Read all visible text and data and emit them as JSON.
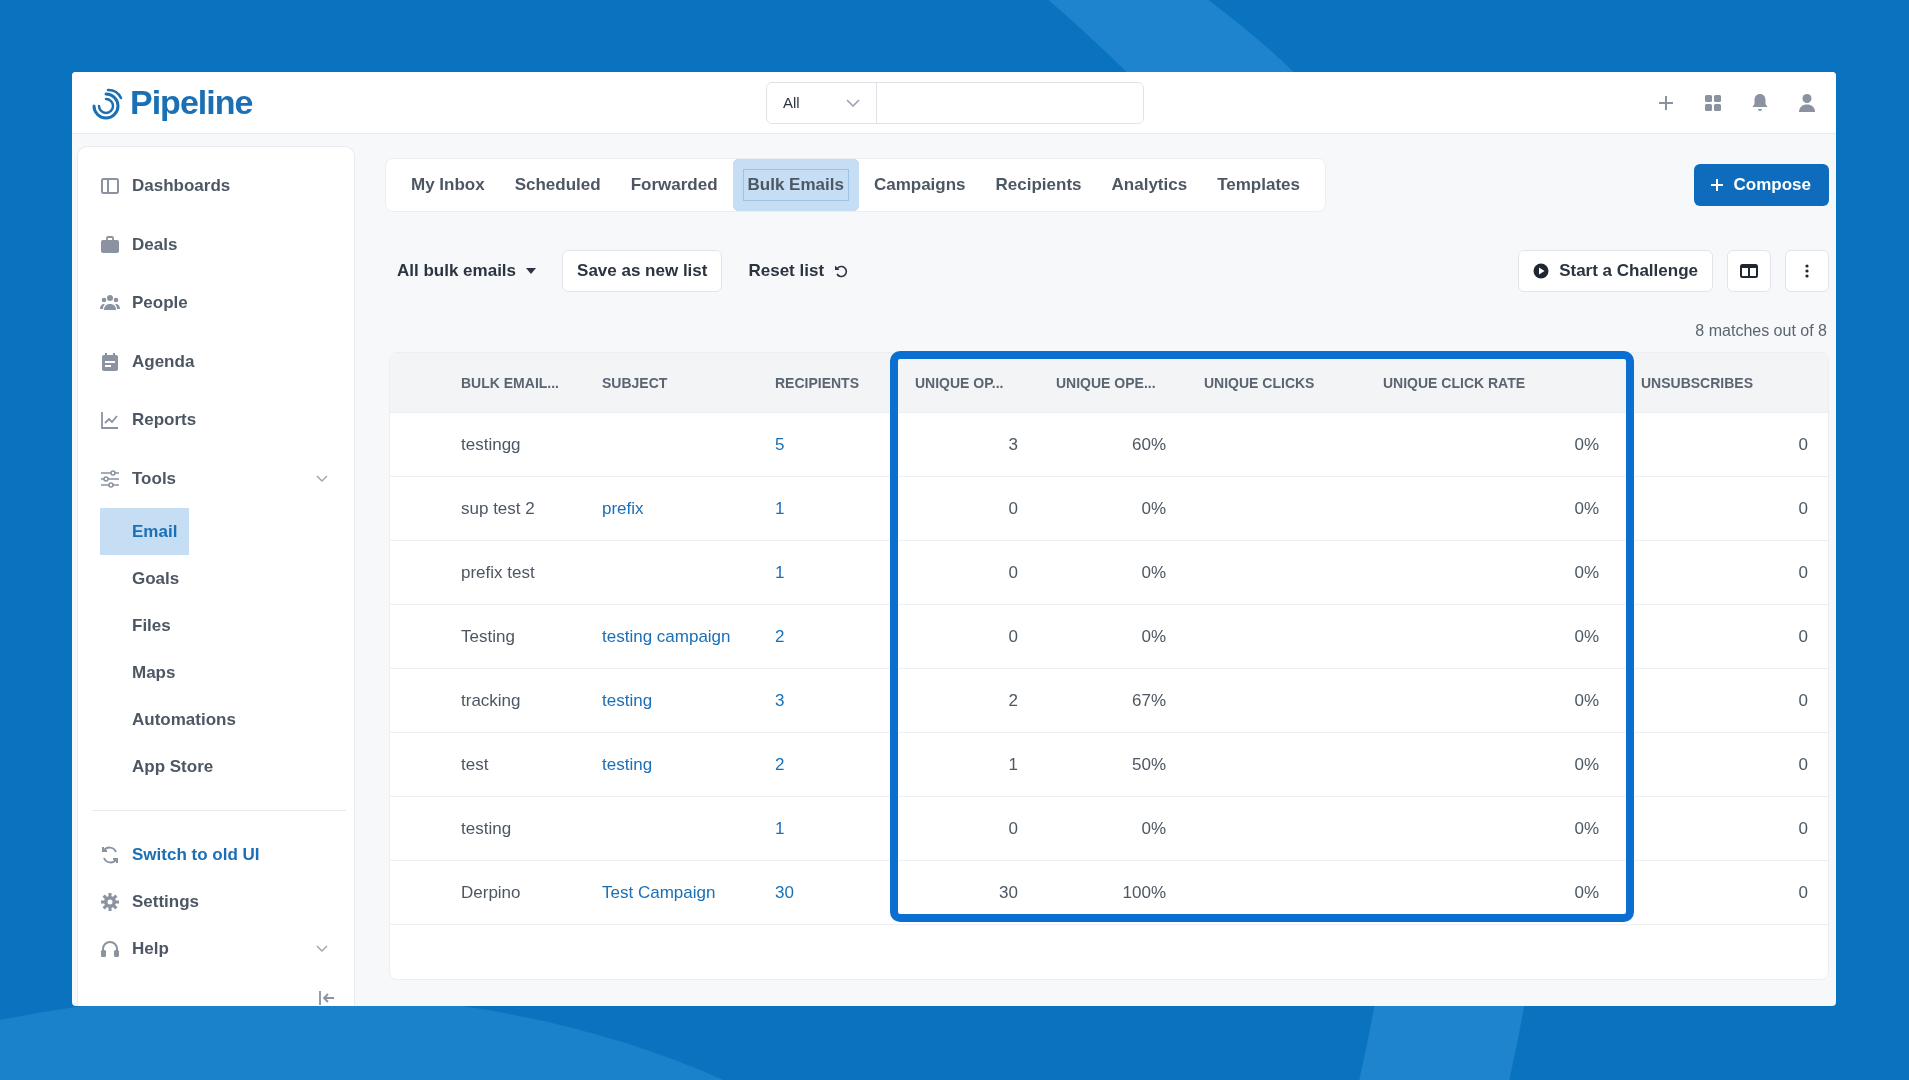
{
  "app": {
    "name": "Pipeline"
  },
  "search": {
    "scope": "All"
  },
  "sidebar": {
    "items": [
      {
        "label": "Dashboards",
        "selected": false
      },
      {
        "label": "Deals",
        "selected": false
      },
      {
        "label": "People",
        "selected": false
      },
      {
        "label": "Agenda",
        "selected": false
      },
      {
        "label": "Reports",
        "selected": false
      },
      {
        "label": "Tools",
        "selected": false,
        "expanded": true,
        "children": [
          {
            "label": "Email",
            "selected": true
          },
          {
            "label": "Goals",
            "selected": false
          },
          {
            "label": "Files",
            "selected": false
          },
          {
            "label": "Maps",
            "selected": false
          },
          {
            "label": "Automations",
            "selected": false
          },
          {
            "label": "App Store",
            "selected": false
          }
        ]
      }
    ],
    "footer": [
      {
        "label": "Switch to old UI",
        "kind": "link"
      },
      {
        "label": "Settings",
        "kind": "item"
      },
      {
        "label": "Help",
        "kind": "menu"
      }
    ]
  },
  "tabs": [
    {
      "label": "My Inbox",
      "selected": false
    },
    {
      "label": "Scheduled",
      "selected": false
    },
    {
      "label": "Forwarded",
      "selected": false
    },
    {
      "label": "Bulk Emails",
      "selected": true
    },
    {
      "label": "Campaigns",
      "selected": false
    },
    {
      "label": "Recipients",
      "selected": false
    },
    {
      "label": "Analytics",
      "selected": false
    },
    {
      "label": "Templates",
      "selected": false
    }
  ],
  "compose_button": "Compose",
  "toolbar": {
    "list_selector": "All bulk emails",
    "save_button": "Save as new list",
    "reset_button": "Reset list",
    "challenge_button": "Start a Challenge"
  },
  "match_count": "8 matches out of 8",
  "table": {
    "columns": [
      "BULK EMAIL...",
      "SUBJECT",
      "RECIPIENTS",
      "UNIQUE OP...",
      "UNIQUE OPE...",
      "UNIQUE CLICKS",
      "UNIQUE CLICK RATE",
      "UNSUBSCRIBES"
    ],
    "rows": [
      {
        "name": "testingg",
        "recipients": "5",
        "unique_opens": "3",
        "unique_open_rate": "60%",
        "unique_click_rate": "0%",
        "unsubscribes": "0"
      },
      {
        "name": "sup test 2",
        "subject": "prefix",
        "recipients": "1",
        "unique_opens": "0",
        "unique_open_rate": "0%",
        "unique_click_rate": "0%",
        "unsubscribes": "0"
      },
      {
        "name": "prefix test",
        "recipients": "1",
        "unique_opens": "0",
        "unique_open_rate": "0%",
        "unique_click_rate": "0%",
        "unsubscribes": "0"
      },
      {
        "name": "Testing",
        "subject": "testing campaign",
        "recipients": "2",
        "unique_opens": "0",
        "unique_open_rate": "0%",
        "unique_click_rate": "0%",
        "unsubscribes": "0"
      },
      {
        "name": "tracking",
        "subject": "testing",
        "recipients": "3",
        "unique_opens": "2",
        "unique_open_rate": "67%",
        "unique_click_rate": "0%",
        "unsubscribes": "0"
      },
      {
        "name": "test",
        "subject": "testing",
        "recipients": "2",
        "unique_opens": "1",
        "unique_open_rate": "50%",
        "unique_click_rate": "0%",
        "unsubscribes": "0"
      },
      {
        "name": "testing",
        "recipients": "1",
        "unique_opens": "0",
        "unique_open_rate": "0%",
        "unique_click_rate": "0%",
        "unsubscribes": "0"
      },
      {
        "name": "Derpino",
        "subject": "Test Campaign",
        "recipients": "30",
        "unique_opens": "30",
        "unique_open_rate": "100%",
        "unique_click_rate": "0%",
        "unsubscribes": "0"
      }
    ]
  }
}
